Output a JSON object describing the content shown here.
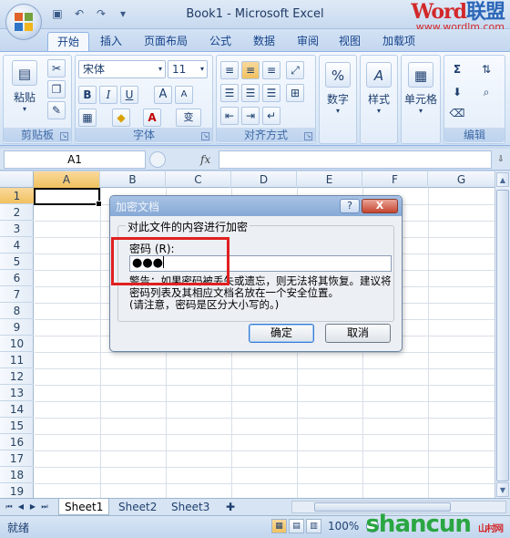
{
  "window": {
    "title": "Book1 - Microsoft Excel",
    "qat_icons": [
      "save-icon",
      "undo-icon",
      "redo-icon",
      "customize-icon"
    ]
  },
  "ribbon_tabs": [
    "开始",
    "插入",
    "页面布局",
    "公式",
    "数据",
    "审阅",
    "视图",
    "加载项"
  ],
  "active_tab": "开始",
  "ribbon": {
    "clipboard": {
      "label": "剪贴板",
      "paste": "粘贴"
    },
    "font": {
      "label": "字体",
      "font_name": "宋体",
      "font_size": "11",
      "bold": "B",
      "italic": "I",
      "underline": "U",
      "grow": "A",
      "shrink": "A",
      "wen": "变"
    },
    "alignment": {
      "label": "对齐方式"
    },
    "number": {
      "label": "数字",
      "symbol": "%"
    },
    "styles": {
      "label": "样式",
      "symbol": "A"
    },
    "cells": {
      "label": "单元格"
    },
    "editing": {
      "label": "编辑",
      "sum": "Σ"
    }
  },
  "formula_bar": {
    "name_box": "A1",
    "fx": "fx",
    "content": ""
  },
  "grid": {
    "columns": [
      "A",
      "B",
      "C",
      "D",
      "E",
      "F",
      "G"
    ],
    "rows": [
      "1",
      "2",
      "3",
      "4",
      "5",
      "6",
      "7",
      "8",
      "9",
      "10",
      "11",
      "12",
      "13",
      "14",
      "15",
      "16",
      "17",
      "18",
      "19"
    ],
    "active_cell": "A1"
  },
  "sheets": [
    "Sheet1",
    "Sheet2",
    "Sheet3"
  ],
  "active_sheet": "Sheet1",
  "status": {
    "text": "就绪",
    "zoom": "100%"
  },
  "dialog": {
    "title": "加密文档",
    "help": "?",
    "close": "X",
    "group_label": "对此文件的内容进行加密",
    "password_label": "密码 (R):",
    "password_value": "●●●",
    "warning": "警告：如果密码被丢失或遗忘，则无法将其恢复。建议将密码列表及其相应文档名放在一个安全位置。",
    "note": "(请注意，密码是区分大小写的。)",
    "ok": "确定",
    "cancel": "取消"
  },
  "watermarks": {
    "top_word": "Word",
    "top_cn": "联盟",
    "top_url": "www.wordlm.com",
    "bottom": "shancun",
    "bottom_cn": "山村网"
  },
  "colors": {
    "highlight": "#e02020",
    "ribbon": "#dde9f7",
    "accent": "#15428b"
  }
}
